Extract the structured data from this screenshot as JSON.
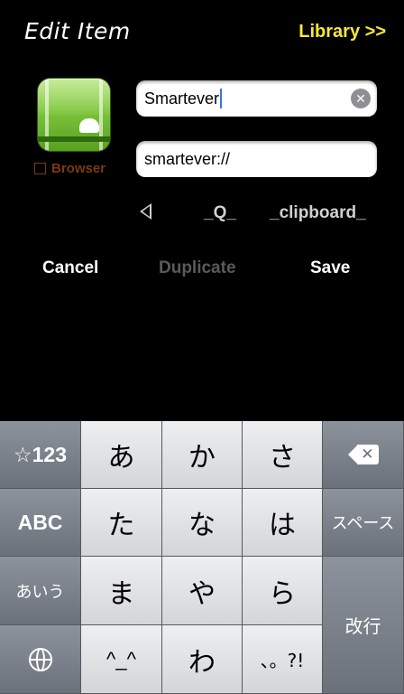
{
  "header": {
    "title": "Edit Item",
    "library_link": "Library >>"
  },
  "app": {
    "browser_label": "Browser",
    "browser_checked": false
  },
  "fields": {
    "name_value": "Smartever",
    "url_value": "smartever://"
  },
  "shortcuts": {
    "q": "_Q_",
    "clipboard": "_clipboard_"
  },
  "actions": {
    "cancel": "Cancel",
    "duplicate": "Duplicate",
    "save": "Save"
  },
  "keyboard": {
    "row1": [
      "☆123",
      "あ",
      "か",
      "さ"
    ],
    "row2": [
      "ABC",
      "た",
      "な",
      "は",
      "スペース"
    ],
    "row3": [
      "あいう",
      "ま",
      "や",
      "ら"
    ],
    "row4": [
      "^_^",
      "わ",
      "、。?!"
    ],
    "return": "改行"
  },
  "colors": {
    "accent_link": "#f5e83a",
    "browser_label": "#7a3a10",
    "background": "#000000"
  }
}
